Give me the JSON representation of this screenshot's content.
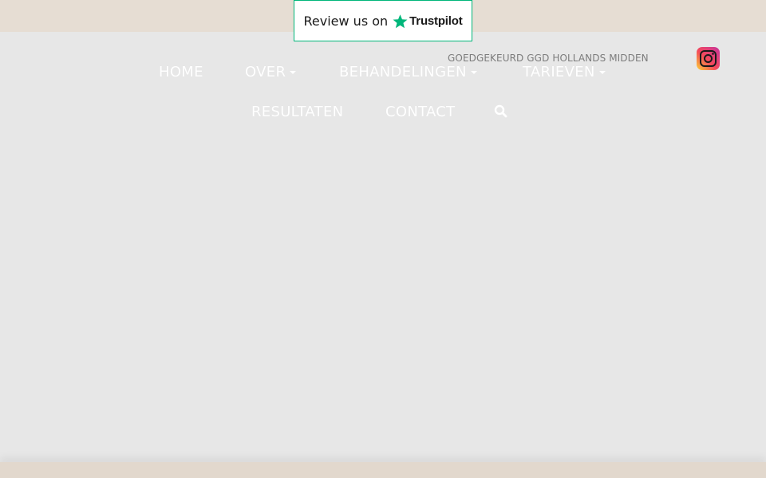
{
  "trustpilot": {
    "review_text": "Review us on",
    "brand": "Trustpilot",
    "brand_color": "#00b67a",
    "icon": "star-icon"
  },
  "header": {
    "ggd_notice": "GOEDGEKEURD GGD HOLLANDS MIDDEN",
    "instagram_icon": "instagram-icon"
  },
  "nav": {
    "items": [
      {
        "label": "HOME",
        "dropdown": false
      },
      {
        "label": "OVER",
        "dropdown": true
      },
      {
        "label": "BEHANDELINGEN",
        "dropdown": true
      },
      {
        "label": "TARIEVEN",
        "dropdown": true
      },
      {
        "label": "RESULTATEN",
        "dropdown": false
      },
      {
        "label": "CONTACT",
        "dropdown": false
      }
    ],
    "search_icon": "search-icon"
  },
  "colors": {
    "top_strip": "#e6ddd3",
    "background": "#e7e7e7",
    "nav_text": "#ffffff"
  }
}
